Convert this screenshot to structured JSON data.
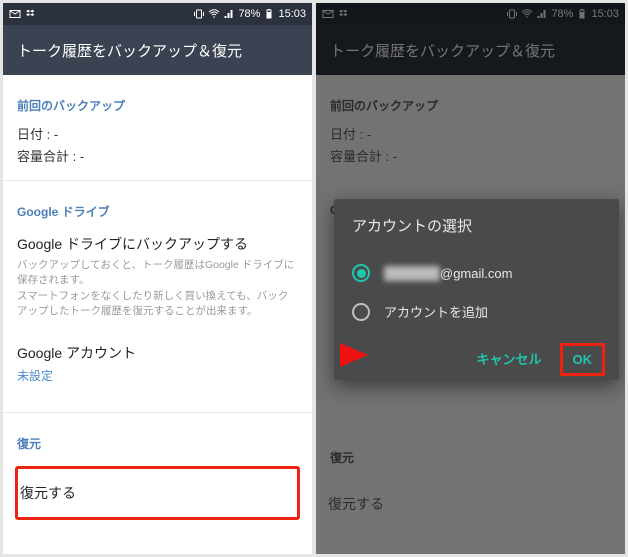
{
  "statusbar": {
    "battery": "78%",
    "time": "15:03"
  },
  "appbar": {
    "title": "トーク履歴をバックアップ＆復元"
  },
  "sections": {
    "lastBackup": {
      "title": "前回のバックアップ",
      "dateLabel": "日付",
      "dateValue": ": -",
      "sizeLabel": "容量合計",
      "sizeValue": ": -"
    },
    "drive": {
      "title": "Google ドライブ",
      "backupTitle": "Google ドライブにバックアップする",
      "backupDesc": "バックアップしておくと、トーク履歴はGoogle ドライブに保存されます。\nスマートフォンをなくしたり新しく買い換えても、バックアップしたトーク履歴を復元することが出来ます。",
      "accountTitle": "Google アカウント",
      "accountValue": "未設定"
    },
    "restore": {
      "title": "復元",
      "action": "復元する"
    }
  },
  "dialog": {
    "title": "アカウントの選択",
    "opt1_suffix": "@gmail.com",
    "opt2": "アカウントを追加",
    "cancel": "キャンセル",
    "ok": "OK"
  }
}
